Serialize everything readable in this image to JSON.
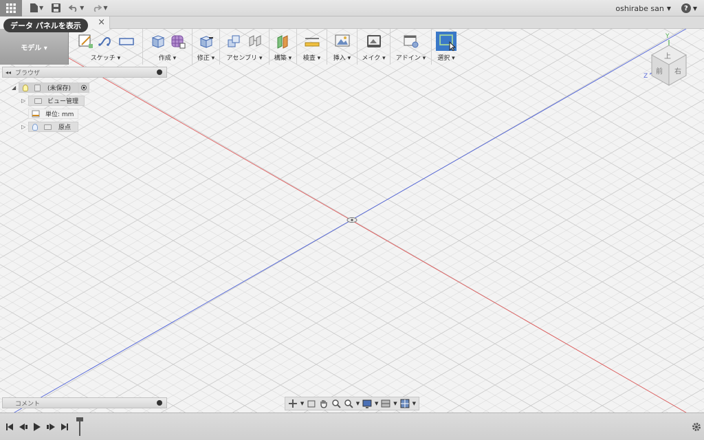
{
  "topbar": {
    "user_label": "oshirabe san",
    "help_label": "?"
  },
  "tooltip": {
    "text": "データ パネルを表示"
  },
  "doc_tab": {
    "close_glyph": "×"
  },
  "toolbar": {
    "workspace_label": "モデル ▾",
    "groups": [
      {
        "label": "スケッチ ▾"
      },
      {
        "label": "作成 ▾"
      },
      {
        "label": "修正 ▾"
      },
      {
        "label": "アセンブリ ▾"
      },
      {
        "label": "構築 ▾"
      },
      {
        "label": "検査 ▾"
      },
      {
        "label": "挿入 ▾"
      },
      {
        "label": "メイク ▾"
      },
      {
        "label": "アドイン ▾"
      },
      {
        "label": "選択 ▾"
      }
    ]
  },
  "browser": {
    "title": "ブラウザ",
    "root": "(未保存)",
    "items": [
      {
        "label": "ビュー管理"
      },
      {
        "label": "単位: mm"
      },
      {
        "label": "原点"
      }
    ]
  },
  "comments": {
    "title": "コメント"
  },
  "viewcube": {
    "top": "上",
    "front": "前",
    "right": "右",
    "z": "Z",
    "y": "Y"
  },
  "colors": {
    "x_axis": "#e05a5a",
    "z_axis": "#4a5ed8",
    "accent": "#3a78c8"
  }
}
